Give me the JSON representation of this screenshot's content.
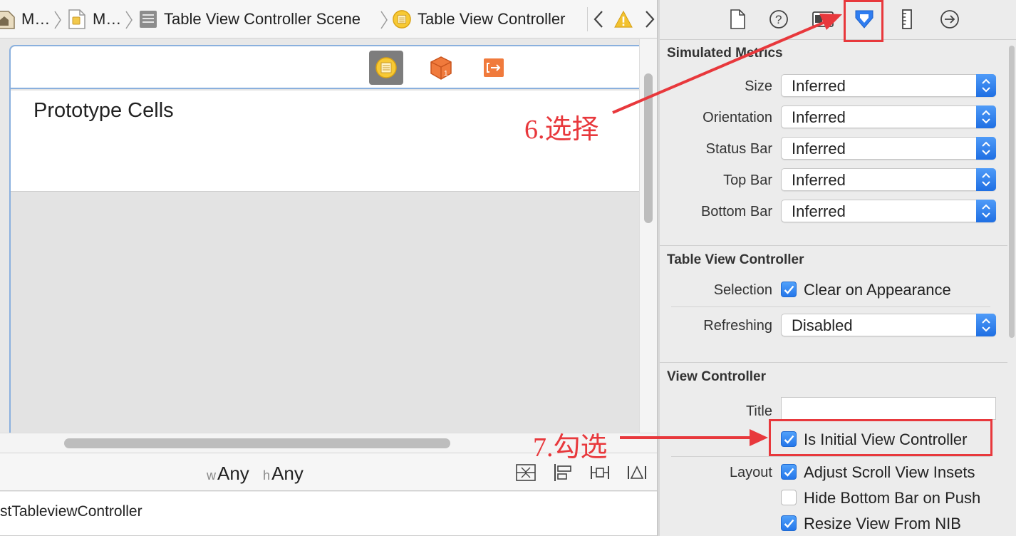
{
  "breadcrumb": {
    "items": [
      "M…",
      "M…",
      "Table View Controller Scene",
      "Table View Controller"
    ]
  },
  "canvas": {
    "prototype_cells_label": "Prototype Cells"
  },
  "size_bar": {
    "width_prefix": "w",
    "width_value": "Any",
    "height_prefix": "h",
    "height_value": "Any"
  },
  "outline": {
    "row_label": "stTableviewController"
  },
  "inspector": {
    "simulated_metrics": {
      "title": "Simulated Metrics",
      "rows": [
        {
          "label": "Size",
          "value": "Inferred"
        },
        {
          "label": "Orientation",
          "value": "Inferred"
        },
        {
          "label": "Status Bar",
          "value": "Inferred"
        },
        {
          "label": "Top Bar",
          "value": "Inferred"
        },
        {
          "label": "Bottom Bar",
          "value": "Inferred"
        }
      ]
    },
    "table_view_controller": {
      "title": "Table View Controller",
      "selection_label": "Selection",
      "clear_on_appearance": "Clear on Appearance",
      "refreshing_label": "Refreshing",
      "refreshing_value": "Disabled"
    },
    "view_controller": {
      "title": "View Controller",
      "title_label": "Title",
      "title_value": "",
      "is_initial": "Is Initial View Controller",
      "layout_label": "Layout",
      "adjust_scroll": "Adjust Scroll View Insets",
      "hide_bottom_bar": "Hide Bottom Bar on Push",
      "resize_from_nib": "Resize View From NIB"
    }
  },
  "annotations": {
    "step6": "6.选择",
    "step7": "7.勾选"
  },
  "colors": {
    "accent_blue": "#2476ea",
    "annotation_red": "#e8383c",
    "scene_border": "#8ab0de"
  },
  "icons": {
    "breadcrumb": [
      "project-icon",
      "storyboard-file-icon",
      "scene-icon",
      "view-controller-icon",
      "chevron-left-icon",
      "warning-icon",
      "chevron-right-icon"
    ],
    "inspector_tabs": [
      "file-inspector-icon",
      "quick-help-icon",
      "identity-inspector-icon",
      "attributes-inspector-icon",
      "size-inspector-icon",
      "connections-inspector-icon"
    ]
  }
}
